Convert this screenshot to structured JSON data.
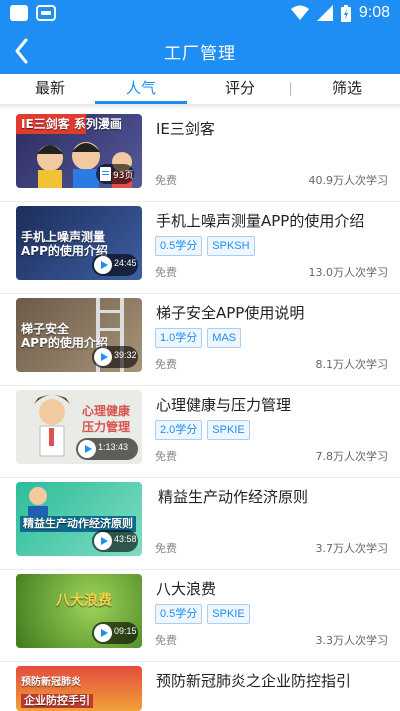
{
  "status_bar": {
    "time": "9:08",
    "left_icons": [
      "notification-square-icon",
      "gamepad-icon"
    ],
    "right_icons": [
      "wifi-icon",
      "signal-icon",
      "battery-icon"
    ]
  },
  "header": {
    "title": "工厂管理",
    "back_icon": "chevron-left-icon",
    "bg_color": "#1e8ef5"
  },
  "tabs": [
    {
      "label": "最新",
      "active": false
    },
    {
      "label": "人气",
      "active": true
    },
    {
      "label": "评分",
      "active": false
    },
    {
      "label": "筛选",
      "active": false
    }
  ],
  "courses": [
    {
      "title": "IE三剑客",
      "thumb_text_1": "IE三剑客 系列漫画",
      "thumb_text_2": "",
      "thumb_badge": "93页",
      "tags": [],
      "price": "免费",
      "learners": "40.9万人次学习"
    },
    {
      "title": "手机上噪声测量APP的使用介绍",
      "thumb_text_1": "手机上噪声测量",
      "thumb_text_2": "APP的使用介绍",
      "thumb_badge": "24:45",
      "tags": [
        "0.5学分",
        "SPKSH"
      ],
      "price": "免费",
      "learners": "13.0万人次学习"
    },
    {
      "title": "梯子安全APP使用说明",
      "thumb_text_1": "梯子安全",
      "thumb_text_2": "APP的使用介绍",
      "thumb_badge": "39:32",
      "tags": [
        "1.0学分",
        "MAS"
      ],
      "price": "免费",
      "learners": "8.1万人次学习"
    },
    {
      "title": "心理健康与压力管理",
      "thumb_text_1": "心理健康",
      "thumb_text_2": "压力管理",
      "thumb_badge": "1:13:43",
      "tags": [
        "2.0学分",
        "SPKIE"
      ],
      "price": "免费",
      "learners": "7.8万人次学习"
    },
    {
      "title": "精益生产动作经济原则",
      "thumb_text_1": "",
      "thumb_text_2": "精益生产动作经济原则",
      "thumb_badge": "43:58",
      "tags": [],
      "price": "免费",
      "learners": "3.7万人次学习"
    },
    {
      "title": "八大浪费",
      "thumb_text_1": "八大浪费",
      "thumb_text_2": "",
      "thumb_badge": "09:15",
      "tags": [
        "0.5学分",
        "SPKIE"
      ],
      "price": "免费",
      "learners": "3.3万人次学习"
    },
    {
      "title": "预防新冠肺炎之企业防控指引",
      "thumb_text_1": "预防新冠肺炎",
      "thumb_text_2": "企业防控手引",
      "thumb_badge": "",
      "tags": [],
      "price": "",
      "learners": ""
    }
  ]
}
